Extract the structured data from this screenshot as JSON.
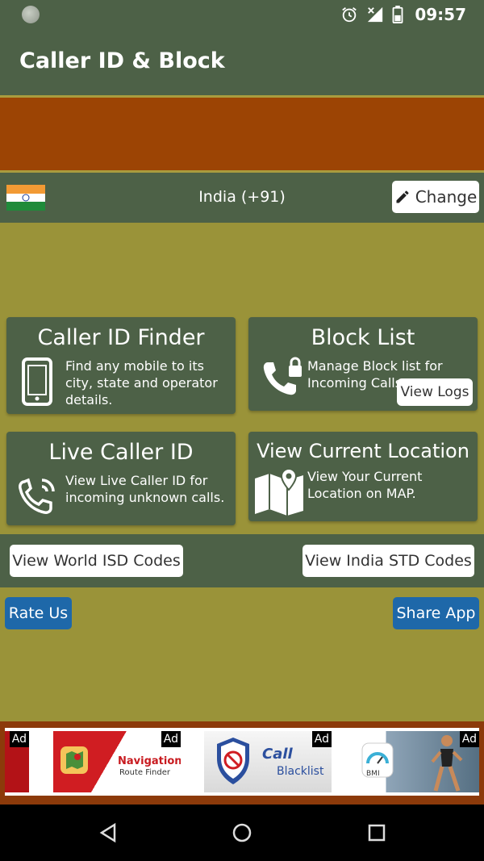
{
  "status_bar": {
    "time": "09:57",
    "icons": [
      "notification-dot-icon",
      "alarm-icon",
      "signal-off-icon",
      "battery-icon"
    ]
  },
  "app_bar": {
    "title": "Caller ID & Block"
  },
  "country": {
    "name": "India (+91)",
    "flag": "india-flag",
    "change_label": "Change"
  },
  "cards": {
    "caller_id_finder": {
      "title": "Caller ID Finder",
      "description": "Find any mobile to its city, state and operator details.",
      "icon": "mobile-phone-icon"
    },
    "block_list": {
      "title": "Block List",
      "description": "Manage Block list for Incoming Calls.",
      "icon": "phone-lock-icon",
      "view_logs_label": "View Logs"
    },
    "live_caller_id": {
      "title": "Live Caller ID",
      "description": "View Live Caller ID for incoming unknown calls.",
      "icon": "phone-ringing-icon"
    },
    "view_current_location": {
      "title": "View Current Location",
      "description": "View Your Current Location on MAP.",
      "icon": "map-pin-icon"
    }
  },
  "codes": {
    "world_isd_label": "View World ISD Codes",
    "india_std_label": "View India STD Codes"
  },
  "actions": {
    "rate_label": "Rate Us",
    "share_label": "Share App"
  },
  "ads": {
    "badge": "Ad",
    "items": [
      {
        "line1": "Navigation",
        "line2": "Route Finder"
      },
      {
        "line1": "Call",
        "line2": "Blacklist"
      },
      {
        "line1": "BMI",
        "line2": ""
      }
    ]
  },
  "colors": {
    "primary_green": "#4d6147",
    "background_olive": "#9a9339",
    "banner_orange": "#9c4404",
    "button_blue": "#1e68a9"
  }
}
